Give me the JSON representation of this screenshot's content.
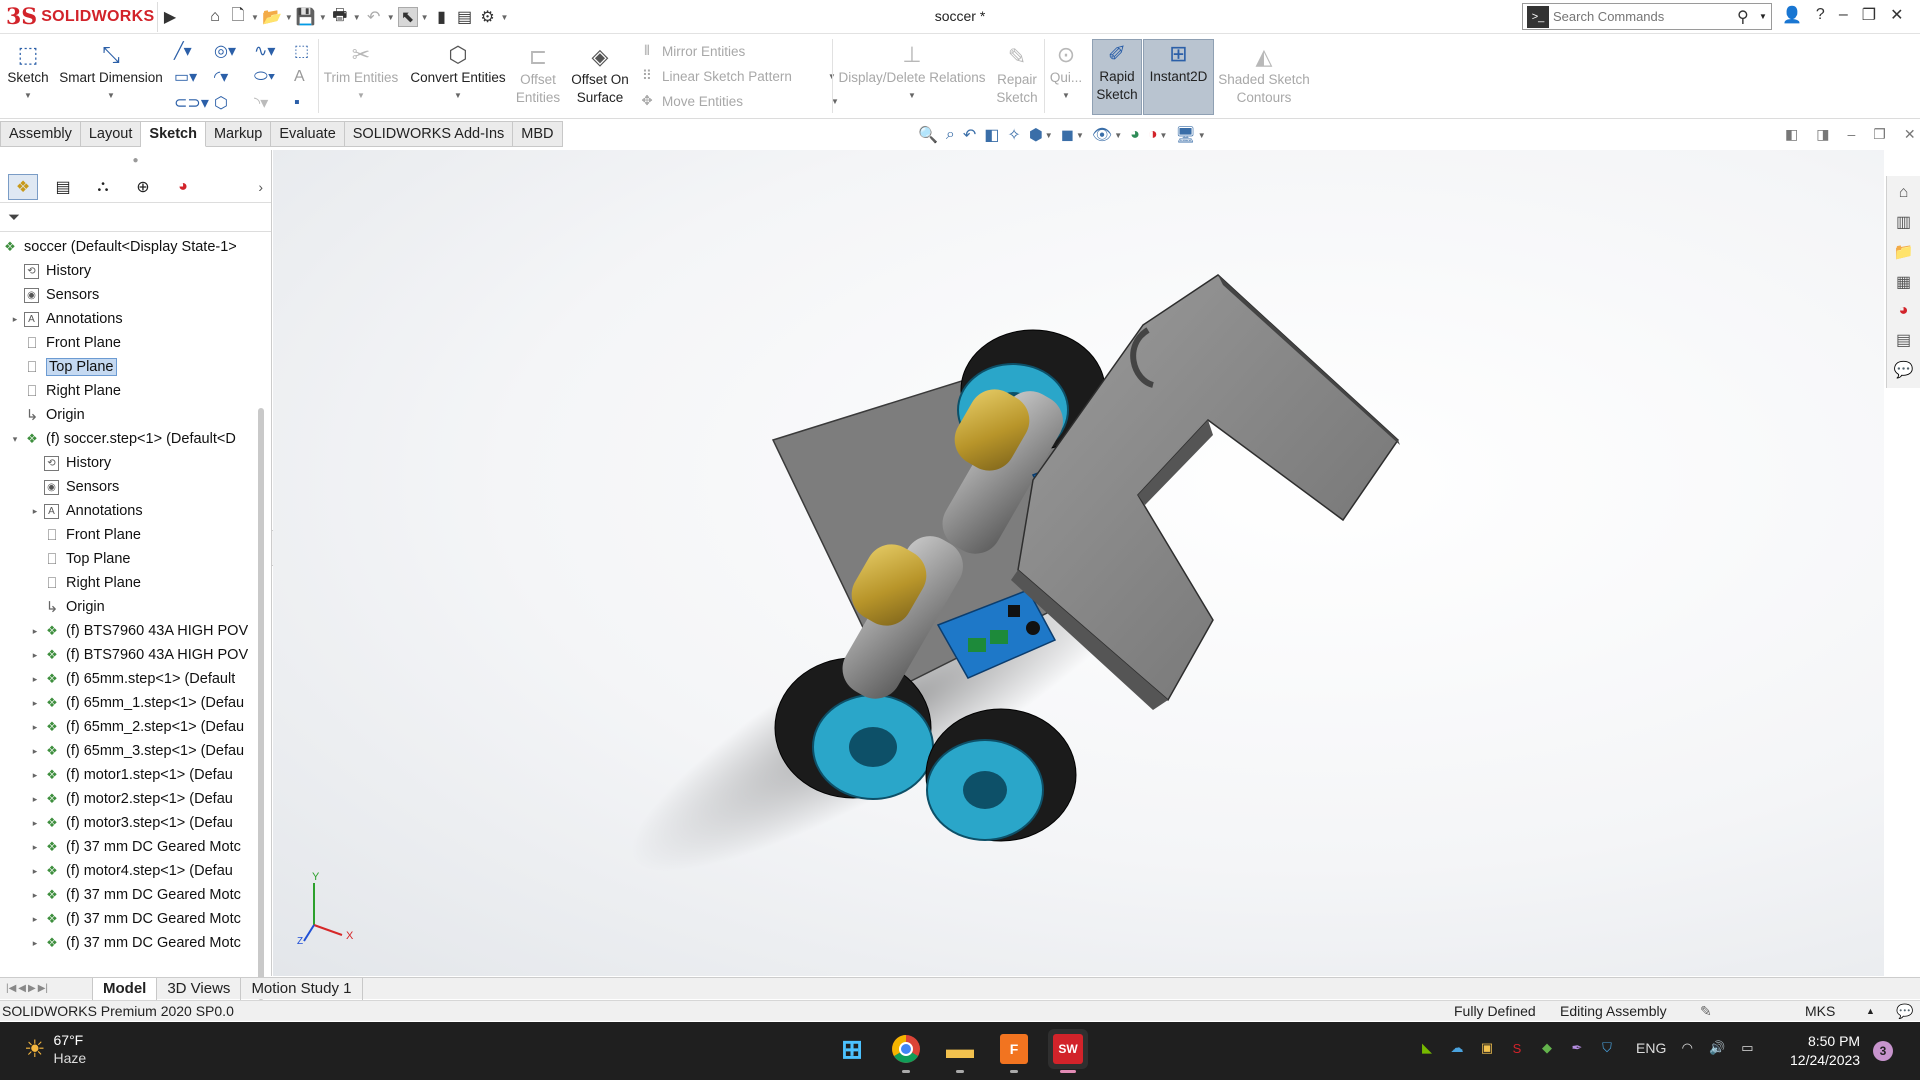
{
  "app": {
    "logo_ds": "3S",
    "logo_text": "SOLIDWORKS",
    "document_title": "soccer *"
  },
  "search": {
    "placeholder": "Search Commands"
  },
  "ribbon": {
    "sketch": "Sketch",
    "smart_dimension": "Smart Dimension",
    "trim_entities": "Trim Entities",
    "convert_entities": "Convert Entities",
    "offset_entities_1": "Offset",
    "offset_entities_2": "Entities",
    "offset_on_surface_1": "Offset On",
    "offset_on_surface_2": "Surface",
    "mirror_entities": "Mirror Entities",
    "linear_sketch_pattern": "Linear Sketch Pattern",
    "move_entities": "Move Entities",
    "display_delete_relations": "Display/Delete Relations",
    "repair_sketch_1": "Repair",
    "repair_sketch_2": "Sketch",
    "quick_snaps": "Qui...",
    "rapid_sketch_1": "Rapid",
    "rapid_sketch_2": "Sketch",
    "instant2d": "Instant2D",
    "shaded_sketch_contours_1": "Shaded Sketch",
    "shaded_sketch_contours_2": "Contours"
  },
  "tabs": [
    "Assembly",
    "Layout",
    "Sketch",
    "Markup",
    "Evaluate",
    "SOLIDWORKS Add-Ins",
    "MBD"
  ],
  "active_tab": "Sketch",
  "tree": {
    "root": "soccer  (Default<Display State-1>",
    "items": [
      {
        "label": "History",
        "icon": "history-icon",
        "level": 1,
        "expand": ""
      },
      {
        "label": "Sensors",
        "icon": "sensors-icon",
        "level": 1,
        "expand": ""
      },
      {
        "label": "Annotations",
        "icon": "annotations-icon",
        "level": 1,
        "expand": "▸"
      },
      {
        "label": "Front Plane",
        "icon": "plane-icon",
        "level": 1,
        "expand": ""
      },
      {
        "label": "Top Plane",
        "icon": "plane-icon",
        "level": 1,
        "expand": "",
        "selected": true
      },
      {
        "label": "Right Plane",
        "icon": "plane-icon",
        "level": 1,
        "expand": ""
      },
      {
        "label": "Origin",
        "icon": "origin-icon",
        "level": 1,
        "expand": ""
      },
      {
        "label": "(f) soccer.step<1> (Default<D",
        "icon": "subassembly-icon",
        "level": 1,
        "expand": "▾"
      },
      {
        "label": "History",
        "icon": "history-icon",
        "level": 2,
        "expand": ""
      },
      {
        "label": "Sensors",
        "icon": "sensors-icon",
        "level": 2,
        "expand": ""
      },
      {
        "label": "Annotations",
        "icon": "annotations-icon",
        "level": 2,
        "expand": "▸"
      },
      {
        "label": "Front Plane",
        "icon": "plane-icon",
        "level": 2,
        "expand": ""
      },
      {
        "label": "Top Plane",
        "icon": "plane-icon",
        "level": 2,
        "expand": ""
      },
      {
        "label": "Right Plane",
        "icon": "plane-icon",
        "level": 2,
        "expand": ""
      },
      {
        "label": "Origin",
        "icon": "origin-icon",
        "level": 2,
        "expand": ""
      },
      {
        "label": "(f) BTS7960 43A HIGH POV",
        "icon": "subassembly-icon",
        "level": 2,
        "expand": "▸"
      },
      {
        "label": "(f) BTS7960 43A HIGH POV",
        "icon": "subassembly-icon",
        "level": 2,
        "expand": "▸"
      },
      {
        "label": "(f) 65mm.step<1> (Default",
        "icon": "subassembly-icon",
        "level": 2,
        "expand": "▸"
      },
      {
        "label": "(f) 65mm_1.step<1> (Defau",
        "icon": "subassembly-icon",
        "level": 2,
        "expand": "▸"
      },
      {
        "label": "(f) 65mm_2.step<1> (Defau",
        "icon": "subassembly-icon",
        "level": 2,
        "expand": "▸"
      },
      {
        "label": "(f) 65mm_3.step<1> (Defau",
        "icon": "subassembly-icon",
        "level": 2,
        "expand": "▸"
      },
      {
        "label": "(f) motor1.step<1> (Defau",
        "icon": "subassembly-icon",
        "level": 2,
        "expand": "▸"
      },
      {
        "label": "(f) motor2.step<1> (Defau",
        "icon": "subassembly-icon",
        "level": 2,
        "expand": "▸"
      },
      {
        "label": "(f) motor3.step<1> (Defau",
        "icon": "subassembly-icon",
        "level": 2,
        "expand": "▸"
      },
      {
        "label": "(f) 37 mm DC Geared Motc",
        "icon": "subassembly-icon",
        "level": 2,
        "expand": "▸"
      },
      {
        "label": "(f) motor4.step<1> (Defau",
        "icon": "subassembly-icon",
        "level": 2,
        "expand": "▸"
      },
      {
        "label": "(f) 37 mm DC Geared Motc",
        "icon": "subassembly-icon",
        "level": 2,
        "expand": "▸"
      },
      {
        "label": "(f) 37 mm DC Geared Motc",
        "icon": "subassembly-icon",
        "level": 2,
        "expand": "▸"
      },
      {
        "label": "(f) 37 mm DC Geared Motc",
        "icon": "subassembly-icon",
        "level": 2,
        "expand": "▸"
      }
    ]
  },
  "triad": {
    "x": "X",
    "y": "Y",
    "z": "Z"
  },
  "bottom_tabs": [
    "Model",
    "3D Views",
    "Motion Study 1"
  ],
  "status": {
    "product": "SOLIDWORKS Premium 2020 SP0.0",
    "defined": "Fully Defined",
    "mode": "Editing Assembly",
    "units": "MKS"
  },
  "taskbar": {
    "temperature": "67°F",
    "weather": "Haze",
    "language": "ENG",
    "time": "8:50 PM",
    "date": "12/24/2023",
    "notifications": "3",
    "fusion_label": "F",
    "sw_label": "SW"
  },
  "colors": {
    "brand": "#d2232a",
    "wheel_rim": "#2aa6c9",
    "motor_gold": "#c7a93a",
    "driver_board": "#1e78c8"
  }
}
